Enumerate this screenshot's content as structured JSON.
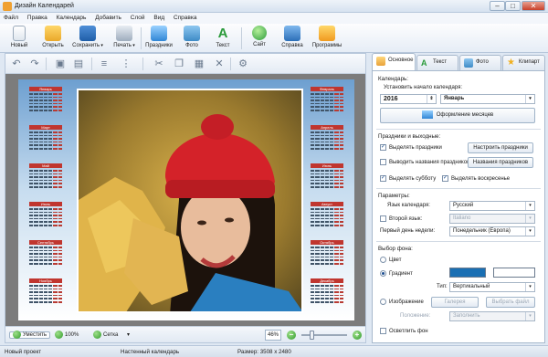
{
  "window": {
    "title": "Дизайн Календарей"
  },
  "menu": [
    "Файл",
    "Правка",
    "Календарь",
    "Добавить",
    "Слой",
    "Вид",
    "Справка"
  ],
  "toolbar": {
    "new": "Новый",
    "open": "Открыть",
    "save": "Сохранить",
    "print": "Печать",
    "holidays": "Праздники",
    "photo": "Фото",
    "text": "Текст",
    "site": "Сайт",
    "help": "Справка",
    "programs": "Программы"
  },
  "canvas": {
    "fit_label": "Уместить",
    "zoom_100": "100%",
    "grid_label": "Сетка",
    "zoom_value": "46%",
    "zoom_level": 0.46,
    "months": [
      "Январь",
      "Февраль",
      "Март",
      "Апрель",
      "Май",
      "Июнь",
      "Июль",
      "Август",
      "Сентябрь",
      "Октябрь",
      "Ноябрь",
      "Декабрь"
    ]
  },
  "side": {
    "tabs": [
      "Основное",
      "Текст",
      "Фото",
      "Клипарт"
    ],
    "calendar_group": "Календарь:",
    "start_label": "Установить начало календаря:",
    "year": "2016",
    "month": "Январь",
    "design_months_btn": "Оформление месяцев",
    "holidays_group": "Праздники и выходные:",
    "highlight_holidays": "Выделять праздники",
    "setup_holidays_btn": "Настроить праздники",
    "show_holiday_names": "Выводить названия праздников",
    "holiday_names_btn": "Названия праздников",
    "highlight_saturday": "Выделять субботу",
    "highlight_sunday": "Выделять воскресенье",
    "params_group": "Параметры:",
    "lang_label": "Язык календаря:",
    "lang_value": "Русский",
    "second_lang_label": "Второй язык:",
    "second_lang_value": "Italiano",
    "first_day_label": "Первый день недели:",
    "first_day_value": "Понедельник (Европа)",
    "bg_group": "Выбор фона:",
    "bg_color": "Цвет",
    "bg_gradient": "Градиент",
    "type_label": "Тип:",
    "type_value": "Вертикальный",
    "bg_image": "Изображение",
    "gallery_btn": "Галерея",
    "choose_file_btn": "Выбрать файл",
    "position_label": "Положение:",
    "position_value": "Заполнить",
    "lighten_bg": "Осветлить фон",
    "gradient_color1": "#1a6fb3",
    "gradient_color2": "#ffffff"
  },
  "status": {
    "project": "Новый проект",
    "calendar_type": "Настенный календарь",
    "size": "Размер: 3508 x 2480"
  }
}
